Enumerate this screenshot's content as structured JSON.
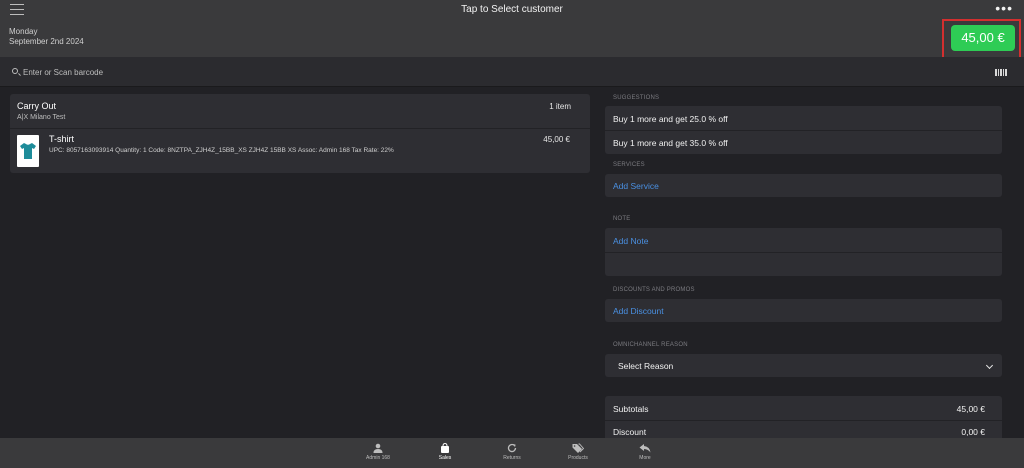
{
  "header": {
    "title": "Tap to Select customer",
    "day": "Monday",
    "date": "September 2nd 2024",
    "total": "45,00 €",
    "total_color": "#2ecc55",
    "highlight_color": "#d32f2f"
  },
  "search": {
    "placeholder": "Enter or Scan barcode"
  },
  "order": {
    "title": "Carry Out",
    "store": "A|X Milano Test",
    "count": "1 item",
    "item": {
      "name": "T-shirt",
      "description": "UPC: 8057163093914 Quantity: 1 Code: 8NZTPA_ZJH4Z_15BB_XS ZJH4Z 15BB XS Assoc: Admin 168 Tax Rate: 22%",
      "price": "45,00 €",
      "thumbnail_color": "#1e8c9a"
    }
  },
  "suggestions": {
    "label": "SUGGESTIONS",
    "items": [
      "Buy 1 more and get 25.0 % off",
      "Buy 1 more and get 35.0 % off"
    ]
  },
  "services": {
    "label": "SERVICES",
    "action": "Add Service"
  },
  "note": {
    "label": "NOTE",
    "action": "Add Note"
  },
  "discounts": {
    "label": "DISCOUNTS AND PROMOS",
    "action": "Add Discount"
  },
  "omnichannel": {
    "label": "OMNICHANNEL REASON",
    "selected": "Select Reason"
  },
  "totals": {
    "subtotal_label": "Subtotals",
    "subtotal_value": "45,00 €",
    "discount_label": "Discount",
    "discount_value": "0,00 €"
  },
  "tabbar": {
    "tabs": [
      {
        "label": "Admin 168",
        "icon": "person-icon"
      },
      {
        "label": "Sales",
        "icon": "shopping-bag-icon"
      },
      {
        "label": "Returns",
        "icon": "refresh-icon"
      },
      {
        "label": "Products",
        "icon": "tags-icon"
      },
      {
        "label": "More",
        "icon": "reply-icon"
      }
    ],
    "active": "Sales"
  },
  "colors": {
    "link": "#4a90e2",
    "background": "#212125",
    "card": "#2e2e33",
    "bar": "#3a3a3c"
  }
}
